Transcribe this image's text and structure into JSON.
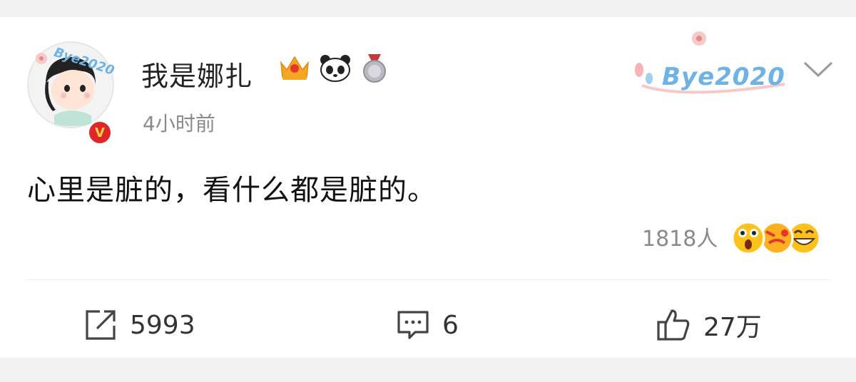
{
  "post": {
    "username": "我是娜扎",
    "timestamp": "4小时前",
    "text": "心里是脏的，看什么都是脏的。",
    "decor_text": "Bye2020",
    "avatar_decor_text": "Bye2020",
    "verified_mark": "V",
    "badges": [
      "crown-badge",
      "panda-badge",
      "medal-badge"
    ]
  },
  "reactions": {
    "count": "1818人",
    "emojis": [
      "shocked-emoji",
      "angry-emoji",
      "laughing-emoji"
    ]
  },
  "actions": {
    "repost": {
      "icon": "share-icon",
      "count": "5993"
    },
    "comment": {
      "icon": "comment-icon",
      "count": "6"
    },
    "like": {
      "icon": "thumbs-up-icon",
      "count": "27万"
    }
  },
  "colors": {
    "background": "#f2f2f2",
    "card": "#ffffff",
    "crown": "#f5a623",
    "verified": "#e0252b",
    "decor_text": "#6fb3e6"
  }
}
